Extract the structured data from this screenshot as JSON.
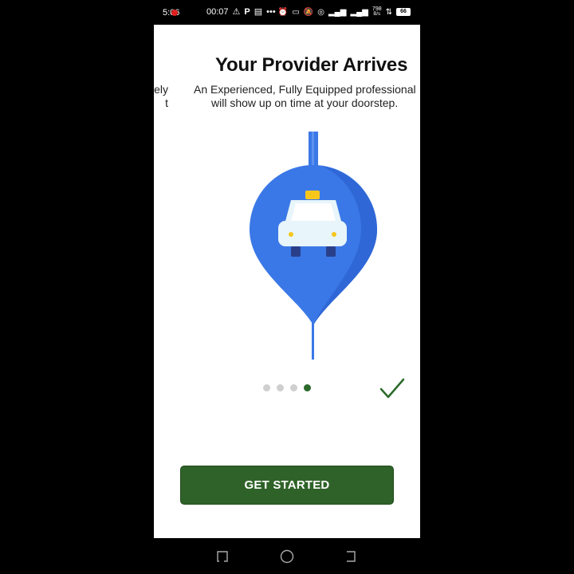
{
  "status_bar": {
    "time": "5:06",
    "rec_time": "00:07",
    "net_speed_value": "798",
    "net_speed_unit": "B/s",
    "battery": "66",
    "more": "•••"
  },
  "onboarding": {
    "title": "Your Provider Arrives",
    "description_line1": "An Experienced, Fully Equipped professional",
    "description_line2": "will show up on time at your doorstep.",
    "prev_fragment_line1": "ely",
    "prev_fragment_line2": "t",
    "page_count": 4,
    "current_page": 4,
    "cta_label": "GET STARTED"
  },
  "colors": {
    "accent_green": "#2f6228",
    "pin_blue": "#3b78e7",
    "dot_inactive": "#cfcfcf"
  },
  "icons": {
    "illustration": "location-pin-taxi-icon",
    "done": "checkmark-icon",
    "nav_recents": "recents-icon",
    "nav_home": "home-icon",
    "nav_back": "back-icon"
  }
}
